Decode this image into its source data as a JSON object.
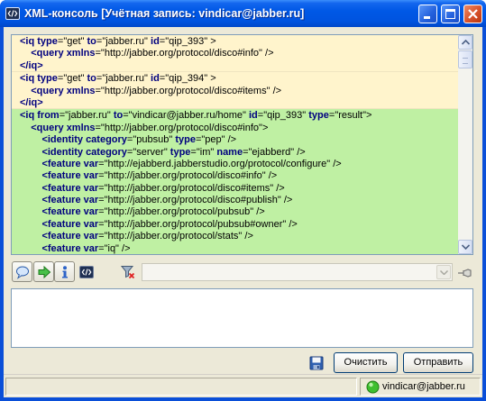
{
  "window": {
    "title": "XML-консоль [Учётная запись: vindicar@jabber.ru]",
    "app_icon": "xml-console-icon",
    "controls": [
      "minimize-icon",
      "maximize-icon",
      "close-icon"
    ]
  },
  "log": {
    "entries": [
      {
        "bg": "#FFF4CC",
        "lines": [
          "<iq type=\"get\" to=\"jabber.ru\" id=\"qip_393\" >",
          "    <query xmlns=\"http://jabber.org/protocol/disco#info\" />",
          "</iq>"
        ]
      },
      {
        "bg": "#FFF4CC",
        "lines": [
          "<iq type=\"get\" to=\"jabber.ru\" id=\"qip_394\" >",
          "    <query xmlns=\"http://jabber.org/protocol/disco#items\" />",
          "</iq>"
        ]
      },
      {
        "bg": "#BFF0A3",
        "lines": [
          "<iq from=\"jabber.ru\" to=\"vindicar@jabber.ru/home\" id=\"qip_393\" type=\"result\">",
          "    <query xmlns=\"http://jabber.org/protocol/disco#info\">",
          "        <identity category=\"pubsub\" type=\"pep\" />",
          "        <identity category=\"server\" type=\"im\" name=\"ejabberd\" />",
          "        <feature var=\"http://ejabberd.jabberstudio.org/protocol/configure\" />",
          "        <feature var=\"http://jabber.org/protocol/disco#info\" />",
          "        <feature var=\"http://jabber.org/protocol/disco#items\" />",
          "        <feature var=\"http://jabber.org/protocol/disco#publish\" />",
          "        <feature var=\"http://jabber.org/protocol/pubsub\" />",
          "        <feature var=\"http://jabber.org/protocol/pubsub#owner\" />",
          "        <feature var=\"http://jabber.org/protocol/stats\" />",
          "        <feature var=\"iq\" />"
        ]
      }
    ]
  },
  "toolbar": {
    "icons": [
      "speech-bubble-icon",
      "arrow-right-icon",
      "info-icon",
      "xml-icon",
      "filter-clear-icon",
      "pin-icon"
    ],
    "filter_value": ""
  },
  "input": {
    "value": ""
  },
  "actions": {
    "save_icon": "save-icon",
    "clear_label": "Очистить",
    "send_label": "Отправить"
  },
  "status": {
    "icon": "online-status-icon",
    "account": "vindicar@jabber.ru"
  },
  "colors": {
    "titlebar": "#0054E3",
    "client_bg": "#ECE9D8",
    "xml_name": "#00007F"
  }
}
